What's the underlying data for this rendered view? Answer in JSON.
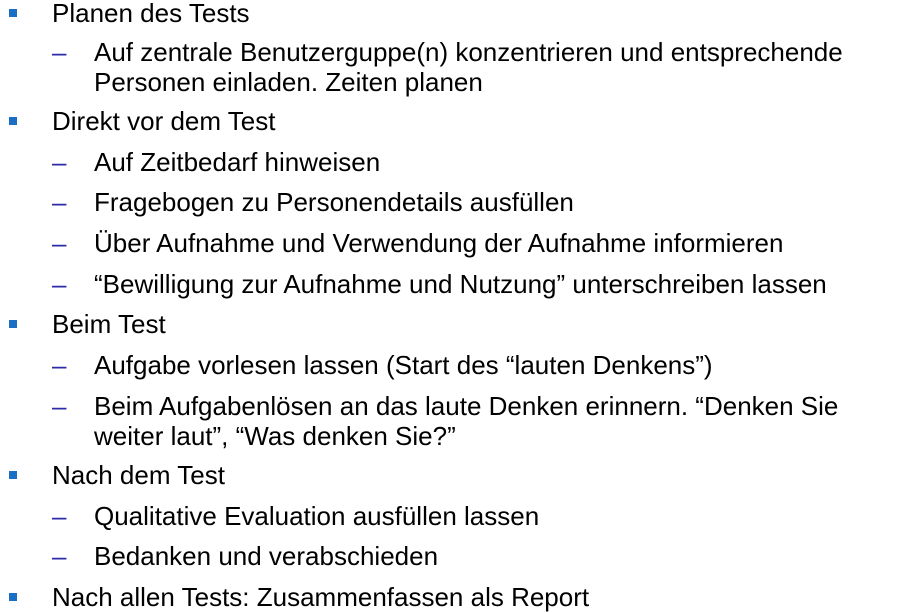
{
  "sections": [
    {
      "title": "Planen des Tests",
      "items": [
        {
          "lines": [
            "Auf zentrale Benutzerguppe(n) konzentrieren und entsprechende",
            "Personen einladen. Zeiten planen"
          ]
        }
      ]
    },
    {
      "title": "Direkt vor dem Test",
      "items": [
        {
          "lines": [
            "Auf Zeitbedarf hinweisen"
          ]
        },
        {
          "lines": [
            "Fragebogen zu Personendetails ausfüllen"
          ]
        },
        {
          "lines": [
            "Über Aufnahme und Verwendung der Aufnahme informieren"
          ]
        },
        {
          "lines": [
            "“Bewilligung zur Aufnahme und Nutzung” unterschreiben lassen"
          ]
        }
      ]
    },
    {
      "title": "Beim Test",
      "items": [
        {
          "lines": [
            "Aufgabe vorlesen lassen (Start des “lauten Denkens”)"
          ]
        },
        {
          "lines": [
            "Beim Aufgabenlösen an das laute Denken erinnern. “Denken Sie",
            "weiter laut”, “Was denken Sie?”"
          ]
        }
      ]
    },
    {
      "title": "Nach dem Test",
      "items": [
        {
          "lines": [
            "Qualitative Evaluation ausfüllen lassen"
          ]
        },
        {
          "lines": [
            "Bedanken und verabschieden"
          ]
        }
      ]
    },
    {
      "title": "Nach allen Tests: Zusammenfassen als Report",
      "items": []
    }
  ],
  "markers": {
    "bullet_color": "#1a6fc4",
    "dash_color": "#2b2baa",
    "dash_glyph": "–"
  }
}
